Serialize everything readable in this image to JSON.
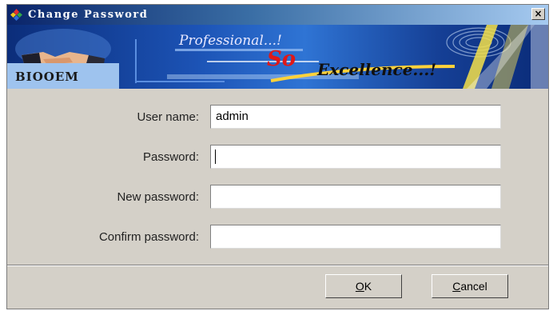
{
  "window": {
    "title": "Change Password",
    "close_symbol": "×",
    "icon": "app-diamond-icon"
  },
  "banner": {
    "brand": "BIOOEM",
    "slogan_top": "Professional...!",
    "slogan_so": "So",
    "slogan_bottom": "Excellence...!"
  },
  "form": {
    "username_label": "User name:",
    "username_value": "admin",
    "password_label": "Password:",
    "password_value": "",
    "new_password_label": "New password:",
    "new_password_value": "",
    "confirm_password_label": "Confirm password:",
    "confirm_password_value": ""
  },
  "buttons": {
    "ok_mnemonic": "O",
    "ok_rest": "K",
    "cancel_mnemonic": "C",
    "cancel_rest": "ancel"
  },
  "colors": {
    "titlebar_start": "#0a246a",
    "titlebar_end": "#a6caf0",
    "dialog_bg": "#d4d0c8",
    "banner_blue": "#1c53b5",
    "slogan_red": "#e01818"
  }
}
